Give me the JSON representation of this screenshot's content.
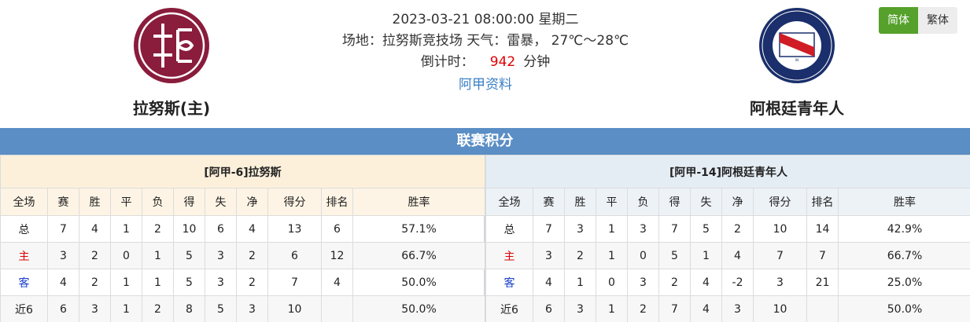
{
  "match": {
    "datetime": "2023-03-21 08:00:00 星期二",
    "venue_weather": "场地：拉努斯竞技场 天气：雷暴， 27℃～28℃",
    "countdown_label": "倒计时：",
    "countdown_value": "942",
    "countdown_unit": "分钟",
    "league_link": "阿甲资料"
  },
  "home_team": {
    "name": "拉努斯(主)",
    "logo_icon": "lanus-crest-icon"
  },
  "away_team": {
    "name": "阿根廷青年人",
    "logo_icon": "argentinos-juniors-crest-icon"
  },
  "lang": {
    "simplified": "简体",
    "traditional": "繁体"
  },
  "section_title": "联赛积分",
  "columns": [
    "全场",
    "赛",
    "胜",
    "平",
    "负",
    "得",
    "失",
    "净",
    "得分",
    "排名",
    "胜率"
  ],
  "home_table": {
    "title": "[阿甲-6]拉努斯",
    "rows": [
      [
        "总",
        "7",
        "4",
        "1",
        "2",
        "10",
        "6",
        "4",
        "13",
        "6",
        "57.1%"
      ],
      [
        "主",
        "3",
        "2",
        "0",
        "1",
        "5",
        "3",
        "2",
        "6",
        "12",
        "66.7%"
      ],
      [
        "客",
        "4",
        "2",
        "1",
        "1",
        "5",
        "3",
        "2",
        "7",
        "4",
        "50.0%"
      ],
      [
        "近6",
        "6",
        "3",
        "1",
        "2",
        "8",
        "5",
        "3",
        "10",
        "",
        "50.0%"
      ]
    ]
  },
  "away_table": {
    "title": "[阿甲-14]阿根廷青年人",
    "rows": [
      [
        "总",
        "7",
        "3",
        "1",
        "3",
        "7",
        "5",
        "2",
        "10",
        "14",
        "42.9%"
      ],
      [
        "主",
        "3",
        "2",
        "1",
        "0",
        "5",
        "1",
        "4",
        "7",
        "7",
        "66.7%"
      ],
      [
        "客",
        "4",
        "1",
        "0",
        "3",
        "2",
        "4",
        "-2",
        "3",
        "21",
        "25.0%"
      ],
      [
        "近6",
        "6",
        "3",
        "1",
        "2",
        "7",
        "4",
        "3",
        "10",
        "",
        "50.0%"
      ]
    ]
  },
  "colors": {
    "accent": "#5b8ec5",
    "home_brand": "#8a1c3c",
    "away_brand": "#1a2f6b",
    "countdown": "#e00000",
    "active_lang": "#55a12b"
  }
}
